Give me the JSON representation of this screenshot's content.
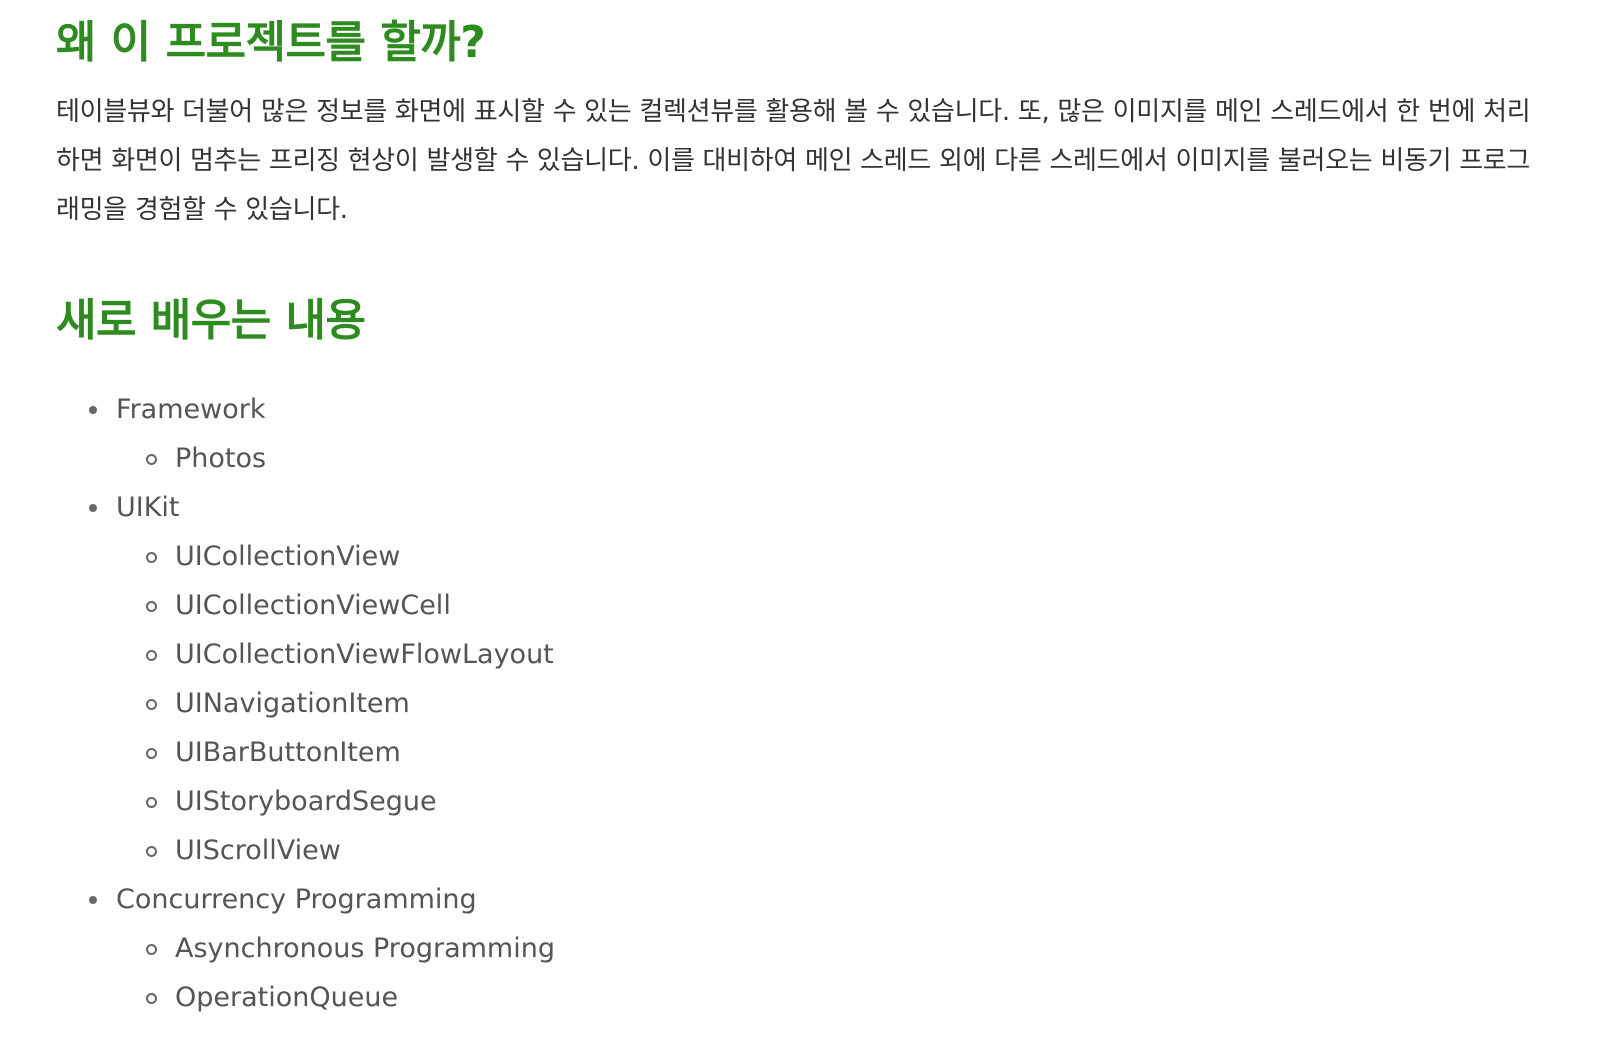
{
  "sections": {
    "why": {
      "heading": "왜 이 프로젝트를 할까?",
      "paragraph": "테이블뷰와 더불어 많은 정보를 화면에 표시할 수 있는 컬렉션뷰를 활용해 볼 수 있습니다. 또, 많은 이미지를 메인 스레드에서 한 번에 처리하면 화면이 멈추는 프리징 현상이 발생할 수 있습니다. 이를 대비하여 메인 스레드 외에 다른 스레드에서 이미지를 불러오는 비동기 프로그래밍을 경험할 수 있습니다."
    },
    "learn": {
      "heading": "새로 배우는 내용",
      "topics": [
        {
          "label": "Framework",
          "items": [
            "Photos"
          ]
        },
        {
          "label": "UIKit",
          "items": [
            "UICollectionView",
            "UICollectionViewCell",
            "UICollectionViewFlowLayout",
            "UINavigationItem",
            "UIBarButtonItem",
            "UIStoryboardSegue",
            "UIScrollView"
          ]
        },
        {
          "label": "Concurrency Programming",
          "items": [
            "Asynchronous Programming",
            "OperationQueue"
          ]
        }
      ]
    }
  },
  "colors": {
    "heading": "#2e8b1f",
    "body_text": "#333333",
    "list_text": "#555555"
  }
}
